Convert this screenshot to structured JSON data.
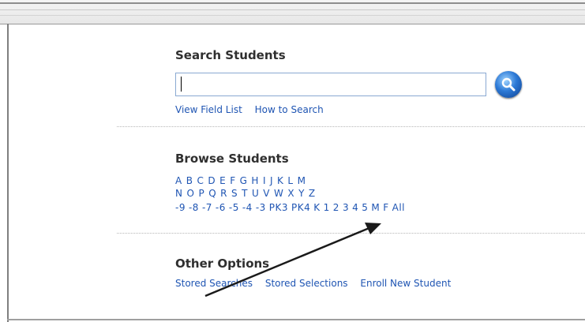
{
  "search": {
    "title": "Search Students",
    "input_value": "",
    "links": [
      "View Field List",
      "How to Search"
    ]
  },
  "browse": {
    "title": "Browse Students",
    "row1": [
      "A",
      "B",
      "C",
      "D",
      "E",
      "F",
      "G",
      "H",
      "I",
      "J",
      "K",
      "L",
      "M"
    ],
    "row2": [
      "N",
      "O",
      "P",
      "Q",
      "R",
      "S",
      "T",
      "U",
      "V",
      "W",
      "X",
      "Y",
      "Z"
    ],
    "row3": [
      "-9",
      "-8",
      "-7",
      "-6",
      "-5",
      "-4",
      "-3",
      "PK3",
      "PK4",
      "K",
      "1",
      "2",
      "3",
      "4",
      "5",
      "M",
      "F",
      "All"
    ]
  },
  "other": {
    "title": "Other Options",
    "links": [
      "Stored Searches",
      "Stored Selections",
      "Enroll New Student"
    ]
  },
  "icons": {
    "search_button": "magnifier-icon",
    "annotation": "arrow-icon"
  },
  "colors": {
    "link": "#1f55b3",
    "title": "#2f2f2f"
  }
}
